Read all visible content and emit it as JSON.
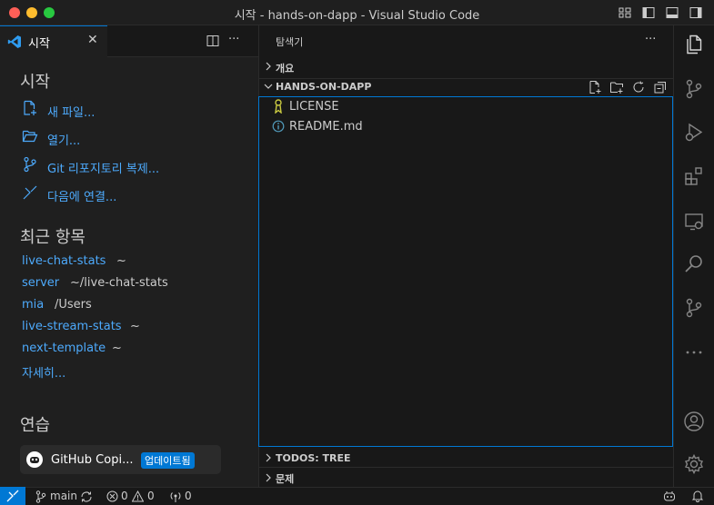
{
  "window": {
    "title": "시작 - hands-on-dapp - Visual Studio Code"
  },
  "editor": {
    "tab_label": "시작",
    "close_glyph": "✕",
    "more_glyph": "···"
  },
  "welcome": {
    "start_heading": "시작",
    "actions": [
      {
        "label": "새 파일...",
        "icon": "new-file-icon"
      },
      {
        "label": "열기...",
        "icon": "folder-open-icon"
      },
      {
        "label": "Git 리포지토리 복제...",
        "icon": "git-clone-icon"
      },
      {
        "label": "다음에 연결...",
        "icon": "remote-connect-icon"
      }
    ],
    "recent_heading": "최근 항목",
    "recent": [
      {
        "name": "live-chat-stats",
        "path": "~"
      },
      {
        "name": "server",
        "path": "~/live-chat-stats"
      },
      {
        "name": "mia",
        "path": "/Users"
      },
      {
        "name": "live-stream-stats",
        "path": "~"
      },
      {
        "name": "next-template",
        "path": "~"
      }
    ],
    "more_link": "자세히...",
    "walkthrough_heading": "연습",
    "walkthrough_card": {
      "title": "GitHub Copi...",
      "badge": "업데이트됨"
    }
  },
  "explorer": {
    "title": "탐색기",
    "more_glyph": "···",
    "outline_section": "개요",
    "project_section": "HANDS-ON-DAPP",
    "files": [
      {
        "name": "LICENSE",
        "icon": "license-icon"
      },
      {
        "name": "README.md",
        "icon": "info-icon"
      }
    ],
    "todos_section": "TODOS: TREE",
    "problems_section": "문제"
  },
  "statusbar": {
    "branch": "main",
    "errors": "0",
    "warnings": "0",
    "ports": "0"
  },
  "colors": {
    "accent": "#0078d4",
    "link": "#4daafc",
    "background": "#1f1f1f",
    "sidebar": "#181818"
  }
}
